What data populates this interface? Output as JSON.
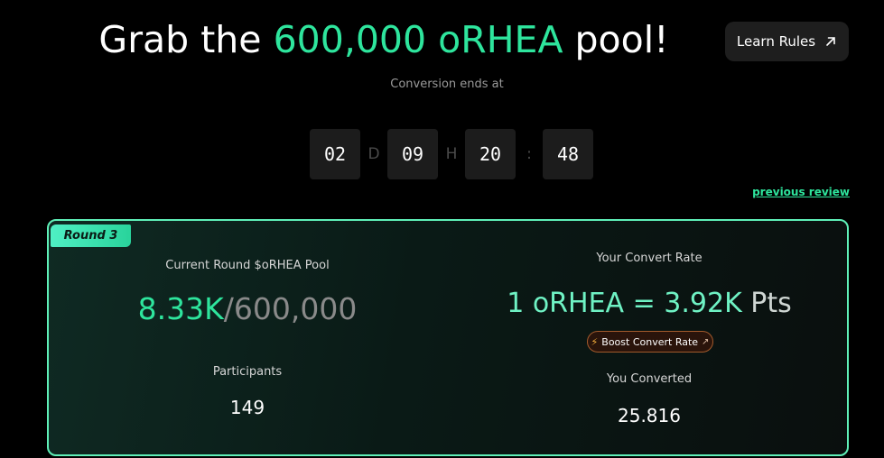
{
  "header": {
    "title_prefix": "Grab the ",
    "title_accent": "600,000 oRHEA",
    "title_suffix": " pool!",
    "learn_rules_label": "Learn Rules",
    "subtitle": "Conversion ends at"
  },
  "countdown": {
    "days": "02",
    "days_unit": "D",
    "hours": "09",
    "hours_unit": "H",
    "minutes": "20",
    "separator": ":",
    "seconds": "48"
  },
  "previous_review_label": "previous review",
  "round": {
    "badge": "Round 3",
    "pool_label": "Current Round $oRHEA Pool",
    "pool_current": "8.33K",
    "pool_total": "/600,000",
    "participants_label": "Participants",
    "participants_value": "149",
    "rate_label": "Your Convert Rate",
    "rate_lhs": "1 oRHEA",
    "rate_eq": " = ",
    "rate_rhs": "3.92K",
    "rate_unit": " Pts",
    "boost_label": "Boost Convert Rate",
    "converted_label": "You Converted",
    "converted_value": "25.816"
  },
  "colors": {
    "accent": "#2ee59d",
    "card_border": "#5ff0b8"
  }
}
